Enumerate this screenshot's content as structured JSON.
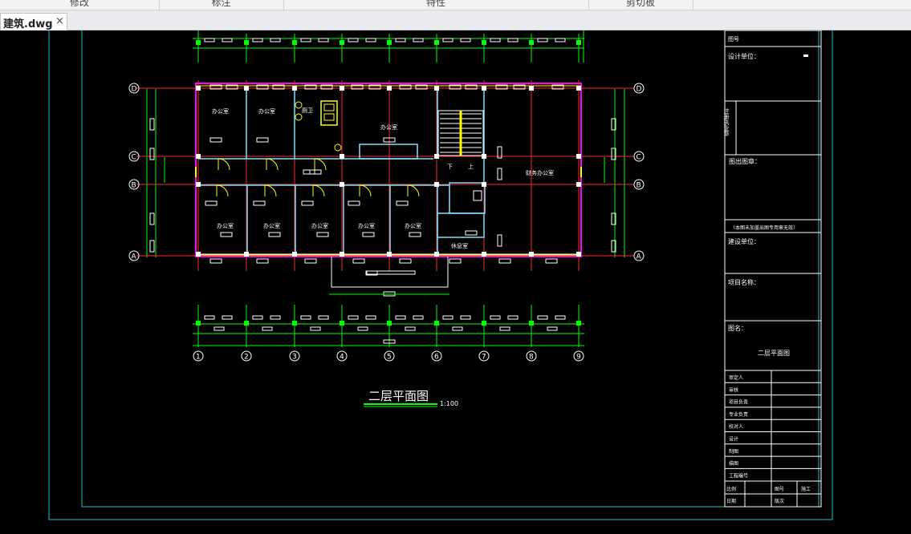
{
  "ribbon": {
    "groups": [
      {
        "label": "修改"
      },
      {
        "label": "标注"
      },
      {
        "label": "特性"
      },
      {
        "label": "剪切板"
      }
    ]
  },
  "tab": {
    "title": "建筑.dwg",
    "close": "×"
  },
  "drawing": {
    "title": "二层平面图",
    "scale": "1:100",
    "axes_row": [
      "D",
      "C",
      "B",
      "A"
    ],
    "axes_col": [
      "1",
      "2",
      "3",
      "4",
      "5",
      "6",
      "7",
      "8",
      "9"
    ],
    "rooms": {
      "office": "办公室",
      "toilet": "厕卫",
      "lounge": "休息室",
      "finance": "财务办公室",
      "down": "下",
      "up": "上"
    },
    "titleblock": {
      "drafter": "图号",
      "design_unit": "设计单位：",
      "registered": "注册执业章",
      "stamp": "图出图章：",
      "note": "（本图未加盖出图专用章无效）",
      "client": "建设单位：",
      "project": "项目名称：",
      "drawing_name_label": "图名：",
      "drawing_name": "二层平面图",
      "rows": [
        "审定人",
        "审核",
        "项目负责",
        "专业负责",
        "校对人",
        "设计",
        "制图",
        "描图",
        "工程编号"
      ],
      "bottom": {
        "scale_label": "比例",
        "sheet_label": "图号",
        "date_label": "日期",
        "version_label": "版次",
        "phase": "施工"
      }
    }
  },
  "colors": {
    "grid": "#00ff00",
    "axis_red": "#ff2a2a",
    "frame": "#19c8d2",
    "wall": "#ffffff",
    "cyan": "#00e5ff",
    "yellow": "#ffff00"
  }
}
